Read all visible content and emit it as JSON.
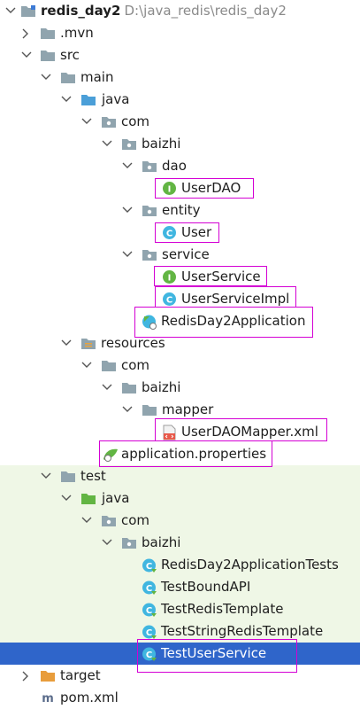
{
  "project": {
    "name": "redis_day2",
    "path": "D:\\java_redis\\redis_day2"
  },
  "tree": {
    "mvn": ".mvn",
    "src": "src",
    "main": "main",
    "java": "java",
    "com": "com",
    "baizhi": "baizhi",
    "dao": "dao",
    "user_dao": "UserDAO",
    "entity": "entity",
    "user": "User",
    "service": "service",
    "user_service": "UserService",
    "user_service_impl": "UserServiceImpl",
    "app": "RedisDay2Application",
    "resources": "resources",
    "res_com": "com",
    "res_baizhi": "baizhi",
    "mapper": "mapper",
    "mapper_xml": "UserDAOMapper.xml",
    "app_props": "application.properties",
    "test": "test",
    "test_java": "java",
    "test_com": "com",
    "test_baizhi": "baizhi",
    "test_items": [
      "RedisDay2ApplicationTests",
      "TestBoundAPI",
      "TestRedisTemplate",
      "TestStringRedisTemplate",
      "TestUserService"
    ],
    "target": "target",
    "pom": "pom.xml"
  },
  "icons": {
    "folder": "folder-icon",
    "package": "package-icon",
    "interface": "interface-icon",
    "class": "class-icon",
    "spring_app": "spring-app-icon",
    "xml": "xml-file-icon",
    "properties": "properties-icon",
    "maven": "maven-icon"
  },
  "colors": {
    "selection": "#2f65ca",
    "test_background": "#eff7e6",
    "highlight": "#d400d4",
    "interface": "#62b543",
    "class": "#40b6e0"
  }
}
